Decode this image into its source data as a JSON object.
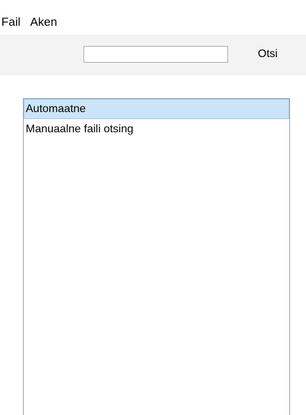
{
  "menu": {
    "items": [
      {
        "label": "Fail"
      },
      {
        "label": "Aken"
      }
    ]
  },
  "toolbar": {
    "search_value": "",
    "search_placeholder": "",
    "search_button_label": "Otsi"
  },
  "list": {
    "items": [
      {
        "label": "Automaatne",
        "selected": true
      },
      {
        "label": "Manuaalne faili otsing",
        "selected": false
      }
    ]
  },
  "colors": {
    "toolbar_bg": "#f3f3f3",
    "selection_bg": "#cce4f7",
    "selection_border": "#99c9ef",
    "list_border": "#9a9a9a"
  }
}
